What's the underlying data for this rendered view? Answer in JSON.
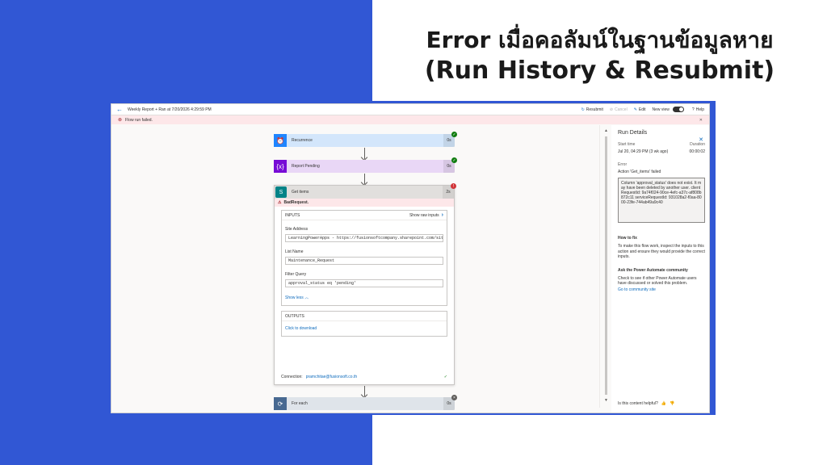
{
  "headline": {
    "line1": "Error เมื่อคอลัมน์ในฐานข้อมูลหาย",
    "line2": "(Run History & Resubmit)"
  },
  "topbar": {
    "title": "Weekly Report + Ran at 7/20/2026 4:29:59 PM",
    "resubmit": "Resubmit",
    "cancel": "Cancel",
    "edit": "Edit",
    "new_view": "New view",
    "help": "Help"
  },
  "error_bar": {
    "text": "Flow run failed."
  },
  "flow": {
    "steps": [
      {
        "label": "Recurrence",
        "duration": "0s",
        "status": "success",
        "color": "#1f85ff",
        "bg": "#d3e6fb",
        "icon": "clock-icon"
      },
      {
        "label": "Report Pending",
        "duration": "0s",
        "status": "success",
        "color": "#770bd6",
        "bg": "#e9d7f6",
        "icon": "variable-icon"
      }
    ],
    "get_items": {
      "label": "Get items",
      "duration": "2s",
      "status": "failed",
      "error": "BadRequest.",
      "inputs_label": "INPUTS",
      "show_raw": "Show raw inputs",
      "fields": [
        {
          "label": "Site Address",
          "value": "LearningPowerApps - https://fusionsoftcompany.sharepoint.com/sites/"
        },
        {
          "label": "List Name",
          "value": "Maintenance_Request"
        },
        {
          "label": "Filter Query",
          "value": "approval_status eq 'pending'"
        }
      ],
      "show_less": "Show less",
      "outputs_label": "OUTPUTS",
      "click_download": "Click to download",
      "connection_label": "Connection:",
      "connection_value": "pramchitae@fusionsoft.co.th"
    },
    "for_each": {
      "label": "For each",
      "duration": "0s",
      "status": "skipped",
      "color": "#486991",
      "bg": "#dfe4ea",
      "icon": "loop-icon"
    }
  },
  "run_details": {
    "title": "Run Details",
    "start_time_label": "Start time",
    "duration_label": "Duration",
    "start_time": "Jul 20, 04:29 PM (3 wk ago)",
    "duration": "00:00:02",
    "error_label": "Error",
    "error_title": "Action 'Get_items' failed",
    "error_body": "Column 'approval_status' does not exist. It may have been deleted by another user. clientRequestId: 9a74f024-90ce-4efc-a37c-af808b872c11 serviceRequestId: 931028a2-f0aa-8000-23fe-744ab49a9c40",
    "how_to_fix_label": "How to fix",
    "how_to_fix": "To make this flow work, inspect the inputs to this action and ensure they would provide the correct inputs.",
    "community_label": "Ask the Power Automate community",
    "community_text": "Check to see if other Power Automate users have discussed or solved this problem.",
    "community_link": "Go to community site",
    "helpful": "Is this content helpful?"
  }
}
